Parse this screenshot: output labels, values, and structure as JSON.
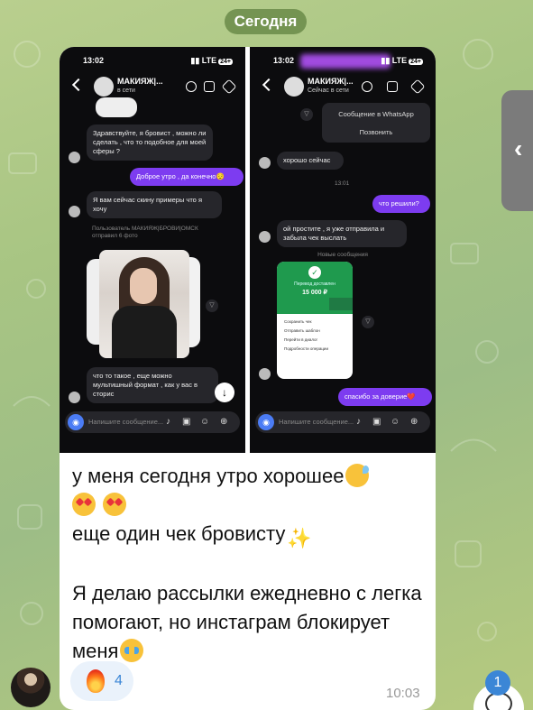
{
  "date_label": "Сегодня",
  "left_screen": {
    "status_time": "13:02",
    "status_signal": "LTE",
    "status_battery": "24+",
    "contact_name": "МАКИЯЖ|...",
    "contact_status": "в сети",
    "msg1": "Здравствуйте, я бровист , можно ли сделать , что то подобное для моей сферы ?",
    "msg2": "Доброе утро , да конечно😌",
    "msg3": "Я вам сейчас скину примеры что я хочу",
    "sys1": "Пользователь МАКИЯЖ|БРОВИ|ОМСК отправил 6 фото",
    "msg4": "что то такое , еще можно мультишный формат , как у вас в сторис",
    "input_placeholder": "Напишите сообщение..."
  },
  "right_screen": {
    "status_time": "13:02",
    "status_signal": "LTE",
    "status_battery": "24+",
    "contact_name": "МАКИЯЖ|...",
    "contact_status": "Сейчас в сети",
    "popup_whatsapp": "Сообщение в WhatsApp",
    "popup_call": "Позвонить",
    "msg1": "хорошо сейчас",
    "time_sep": "13:01",
    "msg2": "что решили?",
    "msg3": "ой простите , я уже отправила и забыла чек выслать",
    "new_messages": "Новые сообщения",
    "receipt_label": "Перевод доставлен",
    "receipt_sum": "15 000 ₽",
    "receipt_items": [
      "Сохранить чек",
      "Отправить шаблон",
      "Перейти в диалог",
      "Подробности операции"
    ],
    "msg4": "спасибо за доверие❤️",
    "input_placeholder": "Напишите сообщение..."
  },
  "caption": {
    "line1": "у меня сегодня утро хорошее",
    "line3": "еще один чек бровисту",
    "line5": "Я делаю рассылки ежедневно с легка помогают, но инстаграм блокирует меня"
  },
  "reaction": {
    "emoji": "fire",
    "count": "4"
  },
  "message_time": "10:03",
  "unread_badge": "1",
  "colors": {
    "accent": "#3b86d6",
    "outgoing": "#7d3cf0",
    "bubble": "#ffffff",
    "date_pill": "#608240"
  }
}
